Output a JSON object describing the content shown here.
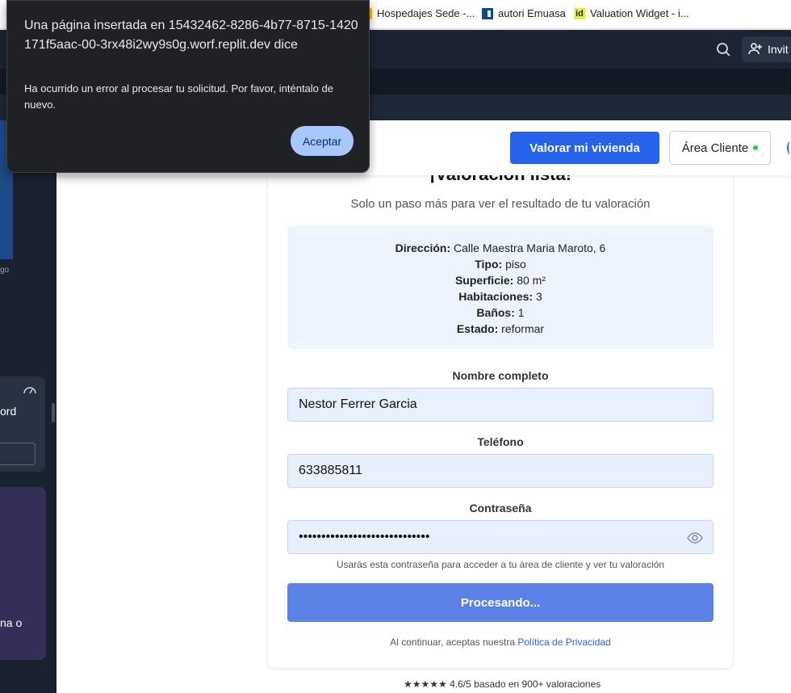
{
  "bookmarks": [
    {
      "label": "Hospedajes Sede -...",
      "icon": "folder-icon"
    },
    {
      "label": "autori Emuasa",
      "icon": "bookmark-icon"
    },
    {
      "label": "Valuation Widget - i...",
      "icon": "id-icon",
      "icon_text": "id"
    }
  ],
  "topbar": {
    "invite_label": "Invit"
  },
  "sidebar": {
    "label_go": "go",
    "label_ord": "ord",
    "label_nao": "na o"
  },
  "dialog": {
    "title": "Una página insertada en 15432462-8286-4b77-8715-1420171f5aac-00-3rx48i2wy9s0g.worf.replit.dev dice",
    "message": "Ha ocurrido un error al procesar tu solicitud. Por favor, inténtalo de nuevo.",
    "button": "Aceptar"
  },
  "header": {
    "valorar_label": "Valorar mi vivienda",
    "area_label": "Área Cliente"
  },
  "card": {
    "title": "¡Valoración lista!",
    "subtitle": "Solo un paso más para ver el resultado de tu valoración",
    "summary": [
      {
        "key": "Dirección:",
        "value": " Calle Maestra Maria Maroto, 6"
      },
      {
        "key": "Tipo:",
        "value": " piso"
      },
      {
        "key": "Superficie:",
        "value": " 80 m²"
      },
      {
        "key": "Habitaciones:",
        "value": " 3"
      },
      {
        "key": "Baños:",
        "value": " 1"
      },
      {
        "key": "Estado:",
        "value": " reformar"
      }
    ],
    "form": {
      "name_label": "Nombre completo",
      "name_value": "Nestor Ferrer Garcia",
      "phone_label": "Teléfono",
      "phone_value": "633885811",
      "password_label": "Contraseña",
      "password_value": "•••••••••••••••••••••••••••••",
      "password_hint": "Usarás esta contraseña para acceder a tu área de cliente y ver tu valoración",
      "submit_label": "Procesando..."
    },
    "legal_prefix": "Al continuar, aceptas nuestra ",
    "legal_link": "Política de Privacidad"
  },
  "rating": "★★★★★ 4.6/5 basado en 900+ valoraciones",
  "colors": {
    "primary": "#2563eb",
    "processing": "#5b82e4",
    "summary_bg": "#eef4fd",
    "dialog_bg": "#202124",
    "dialog_button": "#a8c7fa"
  }
}
